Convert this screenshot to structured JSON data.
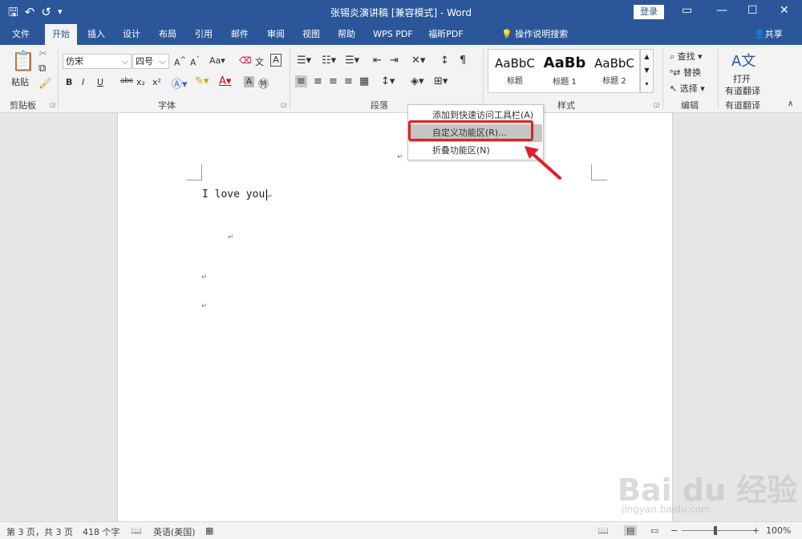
{
  "titlebar": {
    "title": "张锡炎演讲稿 [兼容模式] - Word",
    "login_label": "登录",
    "qat_icons": [
      "save-icon",
      "undo-icon",
      "redo-icon",
      "customize-qat-icon"
    ]
  },
  "tabs": [
    {
      "label": "文件"
    },
    {
      "label": "开始"
    },
    {
      "label": "插入"
    },
    {
      "label": "设计"
    },
    {
      "label": "布局"
    },
    {
      "label": "引用"
    },
    {
      "label": "邮件"
    },
    {
      "label": "审阅"
    },
    {
      "label": "视图"
    },
    {
      "label": "帮助"
    },
    {
      "label": "WPS PDF"
    },
    {
      "label": "福昕PDF"
    }
  ],
  "active_tab": "开始",
  "tellme": {
    "label": "操作说明搜索"
  },
  "share": {
    "label": "共享"
  },
  "ribbon": {
    "clipboard": {
      "paste_label": "粘贴",
      "group_label": "剪贴板"
    },
    "font": {
      "font_name": "仿宋",
      "font_size": "四号",
      "group_label": "字体",
      "buttons": [
        "B",
        "I",
        "U",
        "abc",
        "x₂",
        "x²"
      ],
      "case_label": "Aa"
    },
    "paragraph": {
      "group_label": "段落"
    },
    "styles": {
      "group_label": "样式",
      "items": [
        {
          "sample": "AaBbC",
          "name": "标题"
        },
        {
          "sample": "AaBb",
          "name": "标题 1"
        },
        {
          "sample": "AaBbC",
          "name": "标题 2"
        }
      ]
    },
    "editing": {
      "group_label": "编辑",
      "find": "查找",
      "replace": "替换",
      "select": "选择"
    },
    "translate": {
      "label1": "打开",
      "label2": "有道翻译",
      "group_label": "有道翻译"
    }
  },
  "document": {
    "line1": "I love you"
  },
  "context_menu": {
    "items": [
      {
        "label": "添加到快速访问工具栏(A)"
      },
      {
        "label": "自定义功能区(R)..."
      },
      {
        "label": "折叠功能区(N)"
      }
    ],
    "highlighted_index": 1
  },
  "statusbar": {
    "page": "第 3 页，共 3 页",
    "words": "418 个字",
    "language": "英语(美国)",
    "zoom": "100%"
  },
  "watermark": {
    "text": "Bai du 经验",
    "sub": "jingyan.baidu.com"
  },
  "colors": {
    "accent": "#2b579a",
    "highlight_box": "#e0202a"
  }
}
